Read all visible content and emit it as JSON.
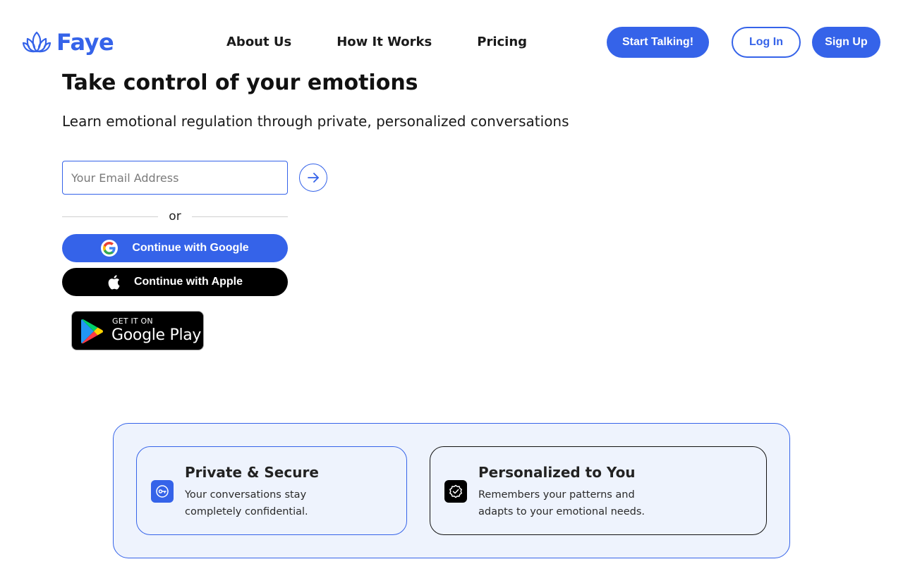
{
  "header": {
    "brand": "Faye",
    "nav": [
      "About Us",
      "How It Works",
      "Pricing"
    ],
    "start_label": "Start Talking!",
    "login_label": "Log In",
    "signup_label": "Sign Up"
  },
  "hero": {
    "title": "Take control of your emotions",
    "subtitle": "Learn emotional regulation through private, personalized conversations",
    "email_placeholder": "Your Email Address",
    "submit_icon": "arrow-right-icon",
    "divider": "or",
    "google_label": "Continue with Google",
    "apple_label": "Continue with Apple",
    "play_small": "GET IT ON",
    "play_big": "Google Play"
  },
  "features": [
    {
      "icon": "key-icon",
      "title": "Private & Secure",
      "description": "Your conversations stay completely confidential."
    },
    {
      "icon": "check-badge-icon",
      "title": "Personalized to You",
      "description": "Remembers your patterns and adapts to your emotional needs."
    }
  ],
  "colors": {
    "accent": "#3563e9",
    "panel": "#eef3fd",
    "dark": "#000000"
  }
}
